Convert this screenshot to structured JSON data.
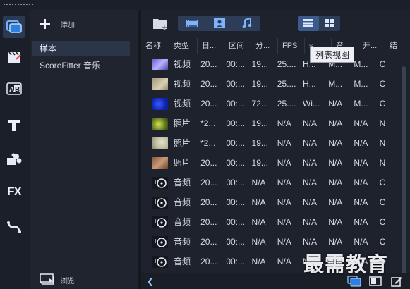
{
  "library": {
    "add_label": "添加",
    "folders": [
      "样本",
      "ScoreFitter 音乐"
    ],
    "browse_label": "浏览"
  },
  "columns": [
    "名称",
    "类型",
    "日...",
    "区间",
    "分...",
    "FPS",
    "s",
    "音",
    "开...",
    "结"
  ],
  "rows": [
    {
      "thumb": "video-purple",
      "type": "视频",
      "date": "20...",
      "duration": "00:...",
      "res": "19...",
      "fps": "25....",
      "c7": "H...",
      "c8": "M...",
      "start": "M...",
      "end": "C"
    },
    {
      "thumb": "video-tan",
      "type": "视频",
      "date": "20...",
      "duration": "00:...",
      "res": "19...",
      "fps": "25....",
      "c7": "H...",
      "c8": "M...",
      "start": "M...",
      "end": "C"
    },
    {
      "thumb": "video-blue",
      "type": "视频",
      "date": "20...",
      "duration": "00:...",
      "res": "72...",
      "fps": "25....",
      "c7": "Wi...",
      "c8": "N/A",
      "start": "M...",
      "end": "C"
    },
    {
      "thumb": "photo-green",
      "type": "照片",
      "date": "*2...",
      "duration": "00:...",
      "res": "19...",
      "fps": "N/A",
      "c7": "N/A",
      "c8": "N/A",
      "start": "N/A",
      "end": "N"
    },
    {
      "thumb": "photo-beige",
      "type": "照片",
      "date": "*2...",
      "duration": "00:...",
      "res": "19...",
      "fps": "N/A",
      "c7": "N/A",
      "c8": "N/A",
      "start": "N/A",
      "end": "N"
    },
    {
      "thumb": "photo-brown",
      "type": "照片",
      "date": "20...",
      "duration": "00:...",
      "res": "19...",
      "fps": "N/A",
      "c7": "N/A",
      "c8": "N/A",
      "start": "N/A",
      "end": "N"
    },
    {
      "thumb": "audio",
      "type": "音频",
      "date": "20...",
      "duration": "00:...",
      "res": "N/A",
      "fps": "N/A",
      "c7": "N/A",
      "c8": "N/A",
      "start": "N/A",
      "end": "C"
    },
    {
      "thumb": "audio",
      "type": "音频",
      "date": "20...",
      "duration": "00:...",
      "res": "N/A",
      "fps": "N/A",
      "c7": "N/A",
      "c8": "N/A",
      "start": "N/A",
      "end": "C"
    },
    {
      "thumb": "audio",
      "type": "音频",
      "date": "20...",
      "duration": "00:...",
      "res": "N/A",
      "fps": "N/A",
      "c7": "N/A",
      "c8": "N/A",
      "start": "N/A",
      "end": "C"
    },
    {
      "thumb": "audio",
      "type": "音频",
      "date": "20...",
      "duration": "00:...",
      "res": "N/A",
      "fps": "N/A",
      "c7": "N/A",
      "c8": "N/A",
      "start": "N/A",
      "end": "C"
    },
    {
      "thumb": "audio",
      "type": "音频",
      "date": "20...",
      "duration": "00:...",
      "res": "N/A",
      "fps": "N/A",
      "c7": "N/A",
      "c8": "N/A",
      "start": "N/A",
      "end": "C"
    }
  ],
  "tooltip": "列表视图",
  "watermark": "最需教育",
  "colors": {
    "accent": "#3c5b8c",
    "icon_blue": "#7eb4ff",
    "bg": "#1b1f2a"
  }
}
